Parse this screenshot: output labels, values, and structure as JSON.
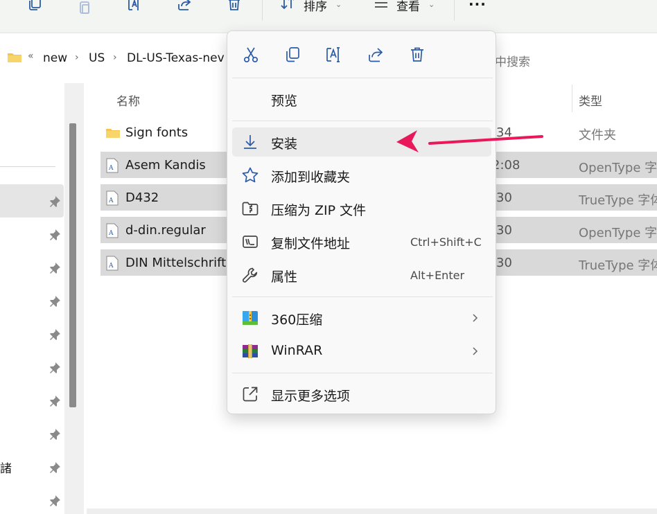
{
  "toolbar": {
    "sort_label": "排序",
    "view_label": "查看",
    "more_label": "···"
  },
  "breadcrumb": {
    "overflow": "«",
    "items": [
      "new",
      "US",
      "DL-US-Texas-nev"
    ],
    "search_placeholder": "中搜索"
  },
  "nav_pane": {
    "partial_item": "諸"
  },
  "file_list": {
    "columns": {
      "name": "名称",
      "type": "类型"
    },
    "rows": [
      {
        "name": "Sign fonts",
        "date": "34",
        "type": "文件夹",
        "kind": "folder"
      },
      {
        "name": "Asem Kandis",
        "date": "2:08",
        "type": "OpenType 字",
        "kind": "font"
      },
      {
        "name": "D432",
        "date": "30",
        "type": "TrueType 字体",
        "kind": "font"
      },
      {
        "name": "d-din.regular",
        "date": "30",
        "type": "OpenType 字",
        "kind": "font"
      },
      {
        "name": "DIN Mittelschrift",
        "date": "30",
        "type": "TrueType 字体",
        "kind": "font"
      }
    ]
  },
  "context_menu": {
    "quick_actions": [
      "cut-icon",
      "copy-icon",
      "rename-icon",
      "share-icon",
      "delete-icon"
    ],
    "items": {
      "preview": {
        "label": "预览"
      },
      "install": {
        "label": "安装",
        "icon": "download-icon"
      },
      "favorite": {
        "label": "添加到收藏夹",
        "icon": "star-icon"
      },
      "zip": {
        "label": "压缩为 ZIP 文件",
        "icon": "zip-folder-icon"
      },
      "copy_path": {
        "label": "复制文件地址",
        "shortcut": "Ctrl+Shift+C",
        "icon": "copy-path-icon"
      },
      "properties": {
        "label": "属性",
        "shortcut": "Alt+Enter",
        "icon": "wrench-icon"
      },
      "zip360": {
        "label": "360压缩",
        "icon": "360-zip-icon"
      },
      "winrar": {
        "label": "WinRAR",
        "icon": "winrar-icon"
      },
      "more": {
        "label": "显示更多选项",
        "icon": "open-external-icon"
      }
    }
  },
  "colors": {
    "accent": "#2a5ba8",
    "arrow": "#e8185a",
    "selection": "#d9d9d9",
    "menu_bg": "#f9f9f9"
  }
}
